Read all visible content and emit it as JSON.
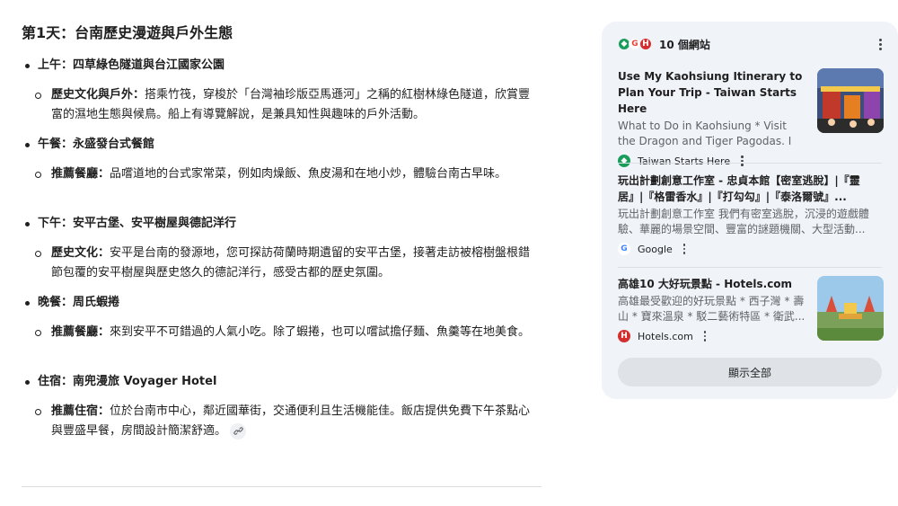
{
  "article": {
    "title": "第1天：台南歷史漫遊與戶外生態",
    "sections": [
      {
        "heading": "上午：四草綠色隧道與台江國家公園",
        "item_label": "歷史文化與戶外：",
        "item_text": "搭乘竹筏，穿梭於「台灣袖珍版亞馬遜河」之稱的紅樹林綠色隧道，欣賞豐富的濕地生態與候鳥。船上有導覽解說，是兼具知性與趣味的戶外活動。"
      },
      {
        "heading": "午餐：永盛發台式餐館",
        "item_label": "推薦餐廳：",
        "item_text": "品嚐道地的台式家常菜，例如肉燥飯、魚皮湯和在地小炒，體驗台南古早味。"
      },
      {
        "heading": "下午：安平古堡、安平樹屋與德記洋行",
        "item_label": "歷史文化：",
        "item_text": "安平是台南的發源地，您可探訪荷蘭時期遺留的安平古堡，接著走訪被榕樹盤根錯節包覆的安平樹屋與歷史悠久的德記洋行，感受古都的歷史氛圍。"
      },
      {
        "heading": "晚餐：周氏蝦捲",
        "item_label": "推薦餐廳：",
        "item_text": "來到安平不可錯過的人氣小吃。除了蝦捲，也可以嚐試擔仔麵、魚羹等在地美食。"
      },
      {
        "heading": "住宿：南兜漫旅 Voyager Hotel",
        "item_label": "推薦住宿：",
        "item_text": "位於台南市中心，鄰近國華街，交通便利且生活機能佳。飯店提供免費下午茶點心與豐盛早餐，房間設計簡潔舒適。"
      }
    ]
  },
  "sources_panel": {
    "count_label": "10 個網站",
    "cards": [
      {
        "title": "Use My Kaohsiung Itinerary to Plan Your Trip - Taiwan Starts Here",
        "snippet": "What to Do in Kaohsiung * Visit the Dragon and Tiger Pagodas. I usually...",
        "source": "Taiwan Starts Here",
        "icon": "taiwan-starts-here-icon"
      },
      {
        "title": "玩出計劃創意工作室 - 忠貞本館【密室逃脫】|『靈居』|『格雷香水』|『打勾勾』|『泰洛爾號』...",
        "snippet": "玩出計劃創意工作室 我們有密室逃脫，沉浸的遊戲體驗、華麗的場景空間、豐富的謎題機關、大型活動...",
        "source": "Google",
        "icon": "google-icon"
      },
      {
        "title": "高雄10 大好玩景點 - Hotels.com",
        "snippet": "高雄最受歡迎的好玩景點 * 西子灣 * 壽山 * 寶來溫泉 * 駁二藝術特區 * 衛武...",
        "source": "Hotels.com",
        "icon": "hotels-com-icon"
      }
    ],
    "show_all_label": "顯示全部"
  }
}
